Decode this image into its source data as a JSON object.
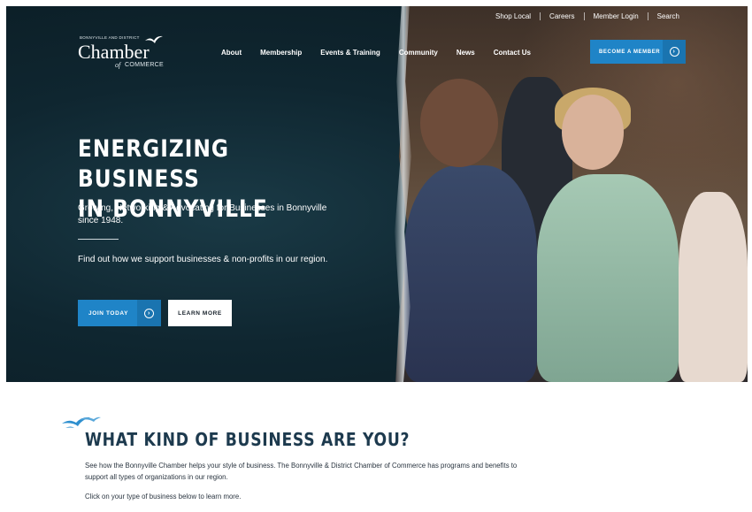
{
  "utility_nav": [
    "Shop Local",
    "Careers",
    "Member Login",
    "Search"
  ],
  "logo": {
    "small": "BONNYVILLE AND DISTRICT",
    "big": "Chamber",
    "of": "of",
    "commerce": "COMMERCE"
  },
  "main_nav": [
    "About",
    "Membership",
    "Events & Training",
    "Community",
    "News",
    "Contact Us"
  ],
  "cta_member": "BECOME A MEMBER",
  "hero": {
    "title_line1": "ENERGIZING BUSINESS",
    "title_line2": "IN BONNYVILLE",
    "subtitle": "Growing, Networking & Advocating for Businesses in Bonnyville since 1948.",
    "body": "Find out how we support businesses & non-profits in our region.",
    "join_label": "JOIN TODAY",
    "learn_label": "LEARN MORE"
  },
  "section": {
    "title": "WHAT KIND OF BUSINESS ARE YOU?",
    "paragraph": "See how the Bonnyville Chamber helps your style of business. The Bonnyville & District Chamber of Commerce has programs and benefits to support all types of organizations in our region.",
    "instruction": "Click on your type of business below to learn more."
  },
  "colors": {
    "accent": "#1f84c7",
    "hero_bg": "#0f2630",
    "section_title": "#1d3a4e"
  },
  "icons": [
    "arrow-circle-icon",
    "bird-logo-icon"
  ]
}
